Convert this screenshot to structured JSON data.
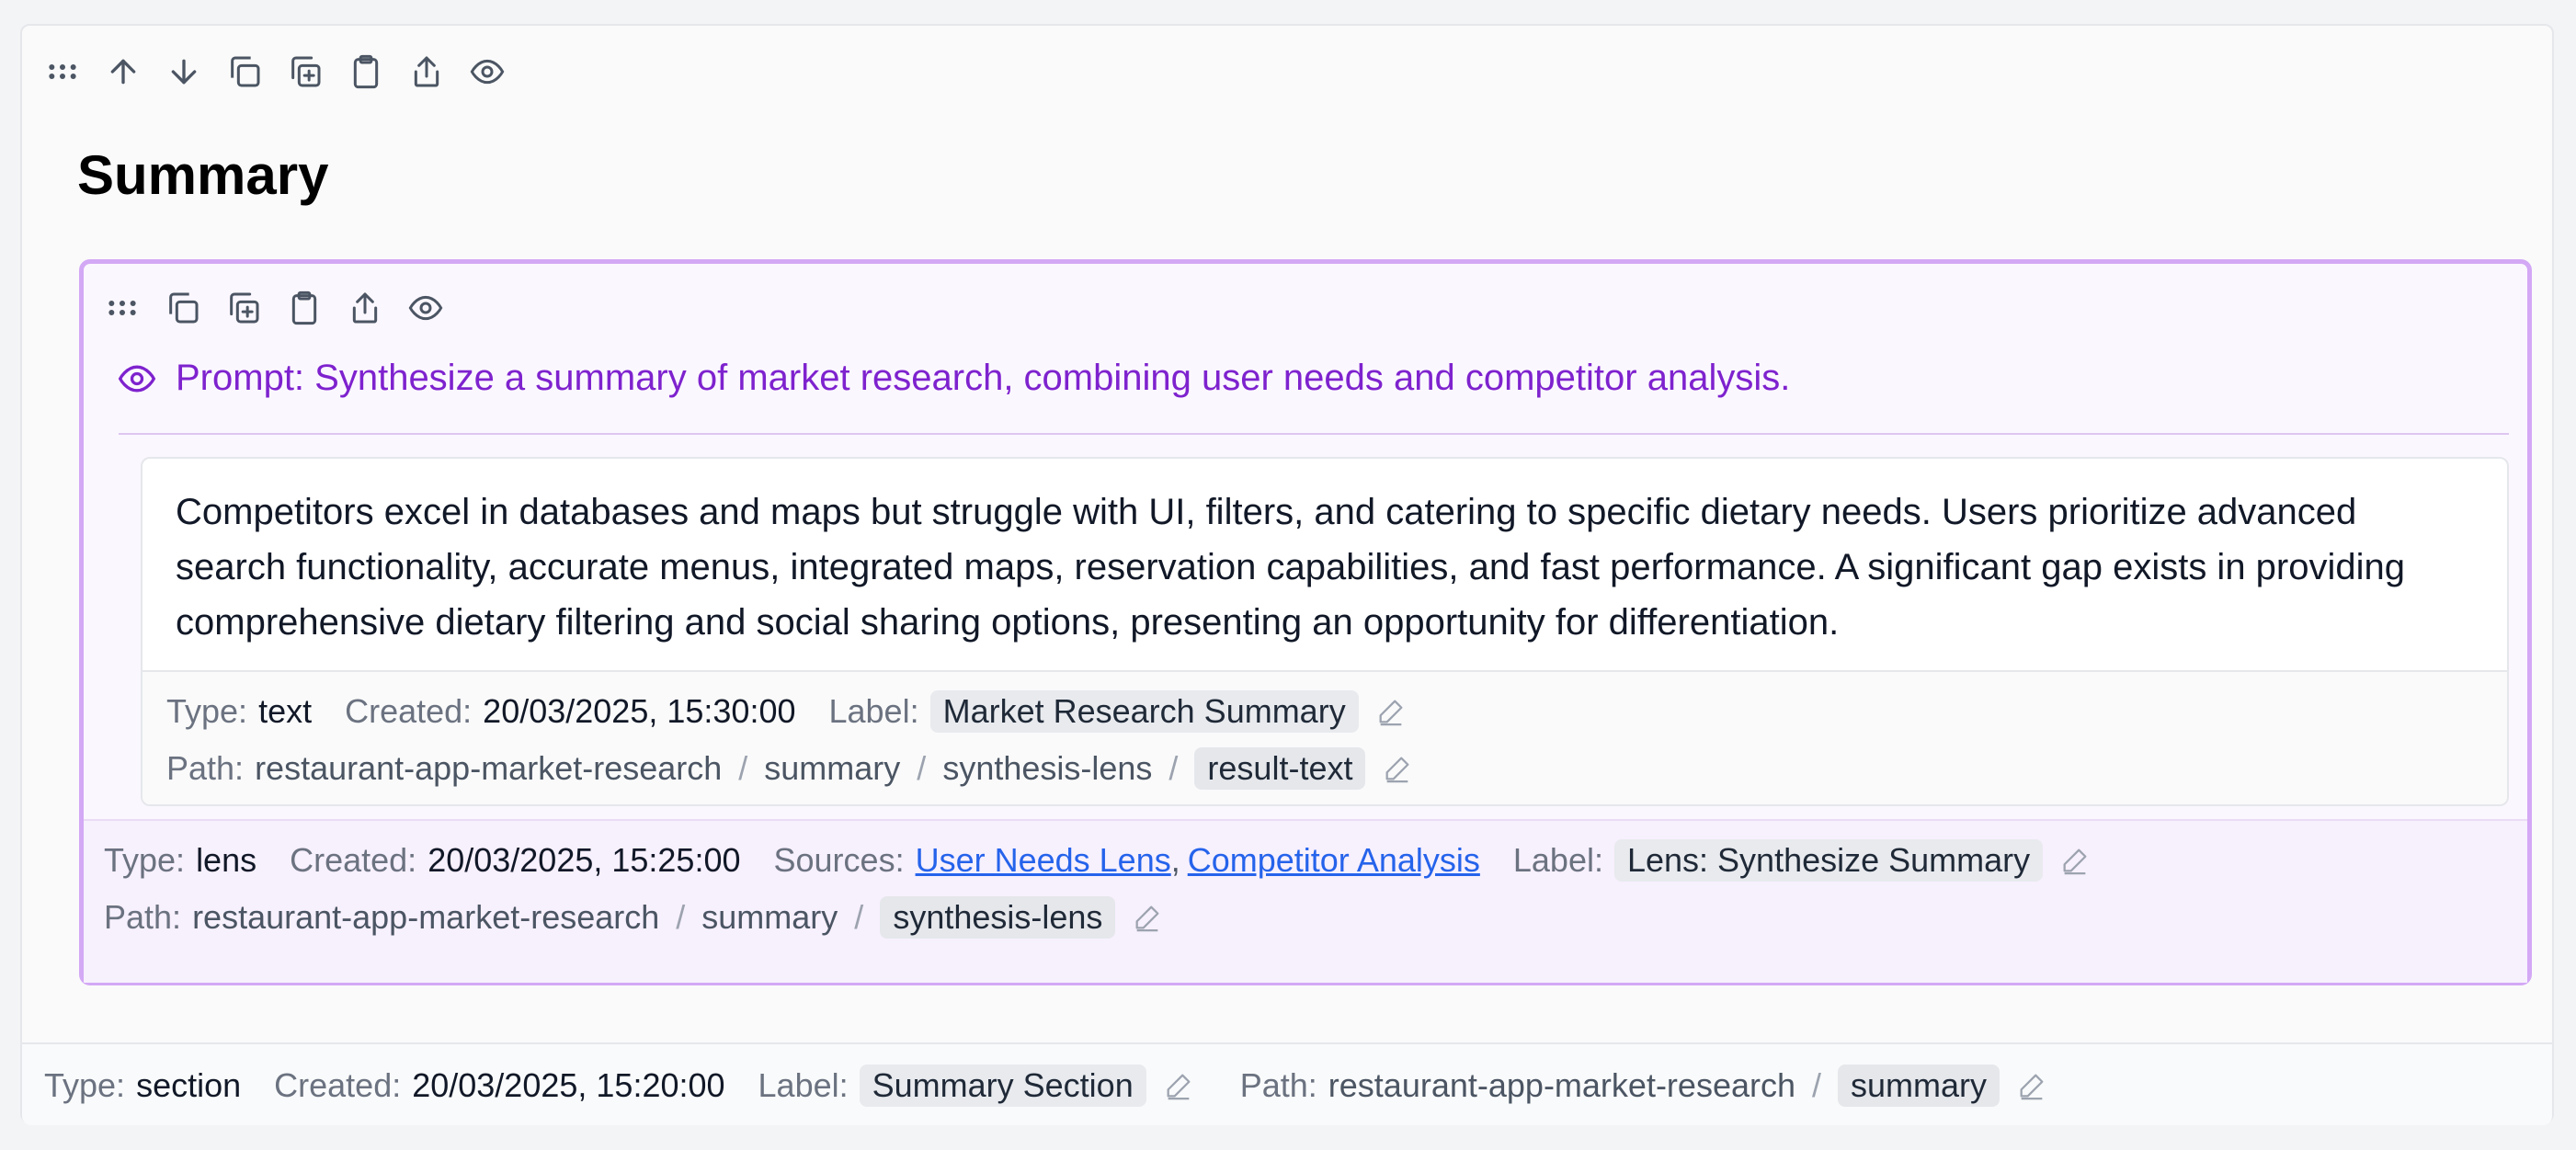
{
  "section": {
    "title": "Summary",
    "toolbar": [
      "drag-handle-icon",
      "arrow-up-icon",
      "arrow-down-icon",
      "copy-icon",
      "duplicate-icon",
      "clipboard-icon",
      "share-icon",
      "eye-icon"
    ],
    "meta": {
      "type_key": "Type:",
      "type_value": "section",
      "created_key": "Created:",
      "created_value": "20/03/2025, 15:20:00",
      "label_key": "Label:",
      "label_value": "Summary Section",
      "path_key": "Path:",
      "path": [
        "restaurant-app-market-research",
        "summary"
      ],
      "separator": "/"
    }
  },
  "lens": {
    "toolbar": [
      "drag-handle-icon",
      "copy-icon",
      "duplicate-icon",
      "clipboard-icon",
      "share-icon",
      "eye-icon"
    ],
    "prompt": "Prompt: Synthesize a summary of market research, combining user needs and competitor analysis.",
    "result": {
      "text": "Competitors excel in databases and maps but struggle with UI, filters, and catering to specific dietary needs. Users prioritize advanced search functionality, accurate menus, integrated maps, reservation capabilities, and fast performance. A significant gap exists in providing comprehensive dietary filtering and social sharing options, presenting an opportunity for differentiation.",
      "meta": {
        "type_key": "Type:",
        "type_value": "text",
        "created_key": "Created:",
        "created_value": "20/03/2025, 15:30:00",
        "label_key": "Label:",
        "label_value": "Market Research Summary",
        "path_key": "Path:",
        "path": [
          "restaurant-app-market-research",
          "summary",
          "synthesis-lens",
          "result-text"
        ],
        "separator": "/"
      }
    },
    "meta": {
      "type_key": "Type:",
      "type_value": "lens",
      "created_key": "Created:",
      "created_value": "20/03/2025, 15:25:00",
      "sources_key": "Sources:",
      "sources": [
        "User Needs Lens ",
        "Competitor Analysis"
      ],
      "sources_sep": ",",
      "label_key": "Label:",
      "label_value": "Lens: Synthesize Summary",
      "path_key": "Path:",
      "path": [
        "restaurant-app-market-research",
        "summary",
        "synthesis-lens"
      ],
      "separator": "/"
    }
  }
}
